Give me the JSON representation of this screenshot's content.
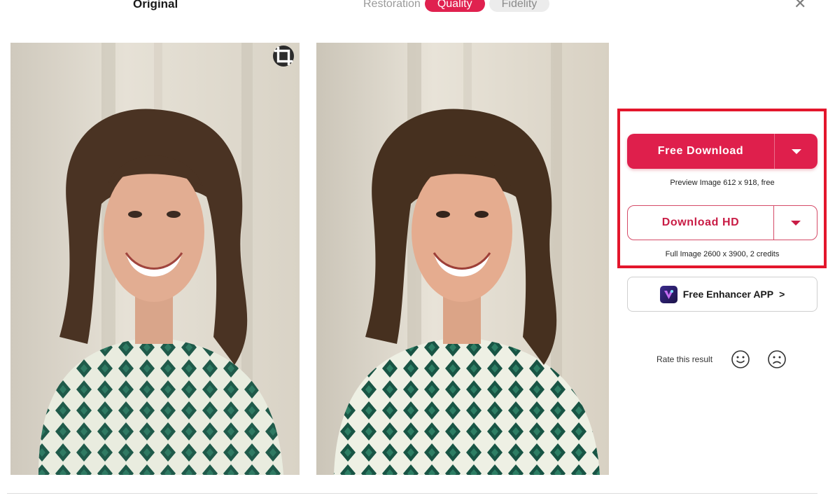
{
  "header": {
    "original_label": "Original",
    "tabs": [
      {
        "label": "Restoration",
        "state": "plain"
      },
      {
        "label": "Quality",
        "state": "active"
      },
      {
        "label": "Fidelity",
        "state": "inactive"
      }
    ],
    "close_glyph": "✕"
  },
  "images": {
    "left_icon": "crop-icon"
  },
  "download": {
    "free_label": "Free Download",
    "free_caption": "Preview Image 612 x 918, free",
    "hd_label": "Download HD",
    "hd_caption": "Full Image 2600 x 3900, 2 credits"
  },
  "app_promo": {
    "label": "Free Enhancer APP",
    "chevron": ">"
  },
  "rating": {
    "label": "Rate this result"
  },
  "colors": {
    "accent": "#e0214f",
    "highlight_border": "#e3162c"
  }
}
